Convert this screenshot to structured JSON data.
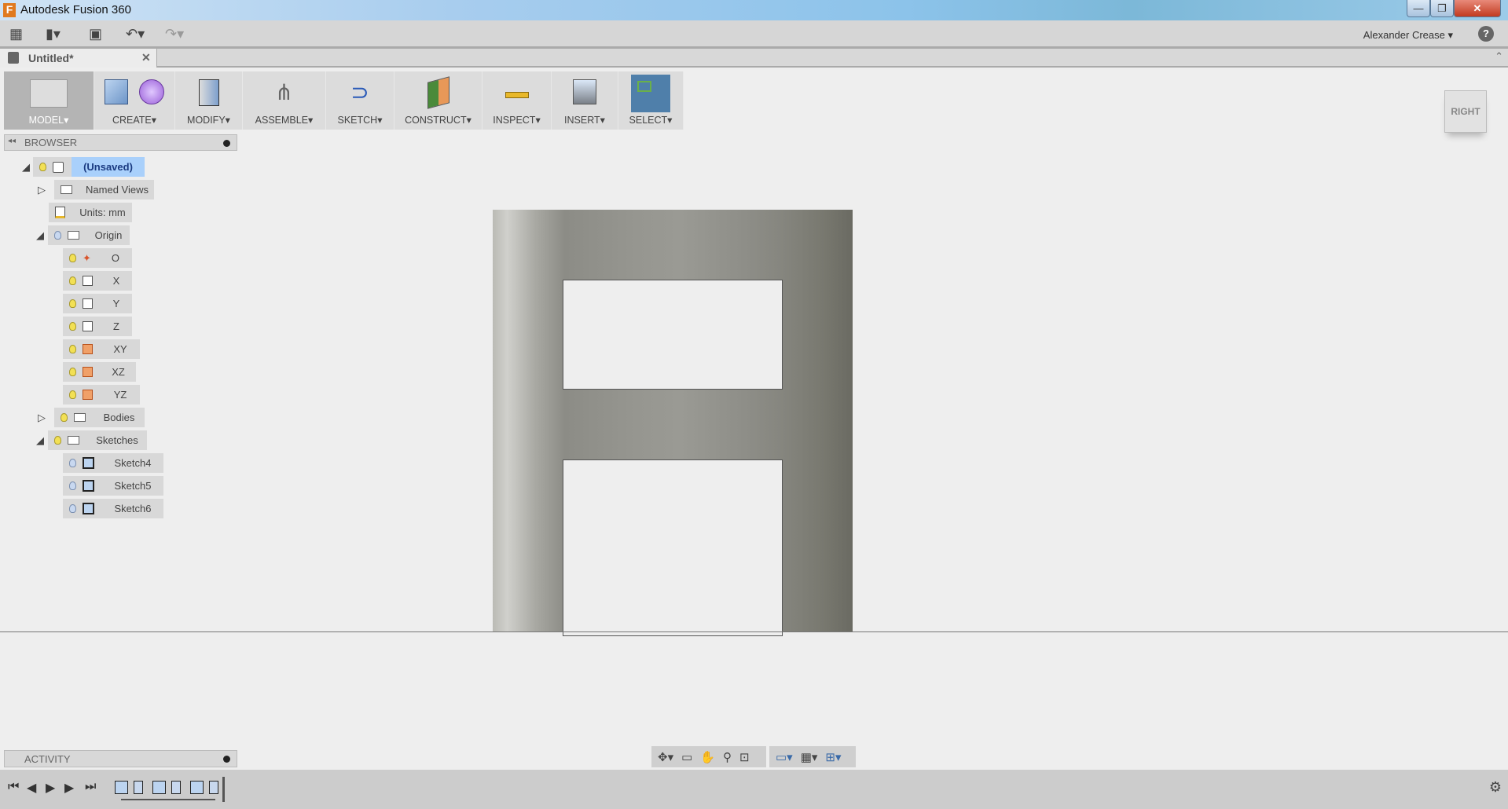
{
  "window": {
    "title": "Autodesk Fusion 360",
    "controls": [
      "minimize",
      "restore",
      "close"
    ]
  },
  "quickbar": {
    "user": "Alexander Crease",
    "icons": [
      "apps-grid-icon",
      "file-icon",
      "save-icon",
      "undo-icon",
      "redo-icon",
      "help-icon"
    ]
  },
  "tab": {
    "label": "Untitled*"
  },
  "ribbon": [
    {
      "label": "MODEL",
      "icons": [
        "model-cube-icon"
      ]
    },
    {
      "label": "CREATE",
      "icons": [
        "box-icon",
        "sphere-icon"
      ]
    },
    {
      "label": "MODIFY",
      "icons": [
        "press-pull-icon"
      ]
    },
    {
      "label": "ASSEMBLE",
      "icons": [
        "joint-icon"
      ]
    },
    {
      "label": "SKETCH",
      "icons": [
        "sketch-curve-icon"
      ]
    },
    {
      "label": "CONSTRUCT",
      "icons": [
        "plane-icon"
      ]
    },
    {
      "label": "INSPECT",
      "icons": [
        "measure-icon"
      ]
    },
    {
      "label": "INSERT",
      "icons": [
        "image-icon"
      ]
    },
    {
      "label": "SELECT",
      "icons": [
        "select-icon"
      ]
    }
  ],
  "browser": {
    "title": "BROWSER",
    "items": [
      {
        "label": "(Unsaved)"
      },
      {
        "label": "Named Views"
      },
      {
        "label": "Units: mm"
      },
      {
        "label": "Origin"
      },
      {
        "label": "O"
      },
      {
        "label": "X"
      },
      {
        "label": "Y"
      },
      {
        "label": "Z"
      },
      {
        "label": "XY"
      },
      {
        "label": "XZ"
      },
      {
        "label": "YZ"
      },
      {
        "label": "Bodies"
      },
      {
        "label": "Sketches"
      },
      {
        "label": "Sketch4"
      },
      {
        "label": "Sketch5"
      },
      {
        "label": "Sketch6"
      }
    ]
  },
  "viewcube": {
    "face": "RIGHT"
  },
  "activity": {
    "title": "ACTIVITY"
  },
  "colors": {
    "accent": "#4f7faa",
    "selected": "#a9d0fb",
    "part": "#8f8f88"
  }
}
